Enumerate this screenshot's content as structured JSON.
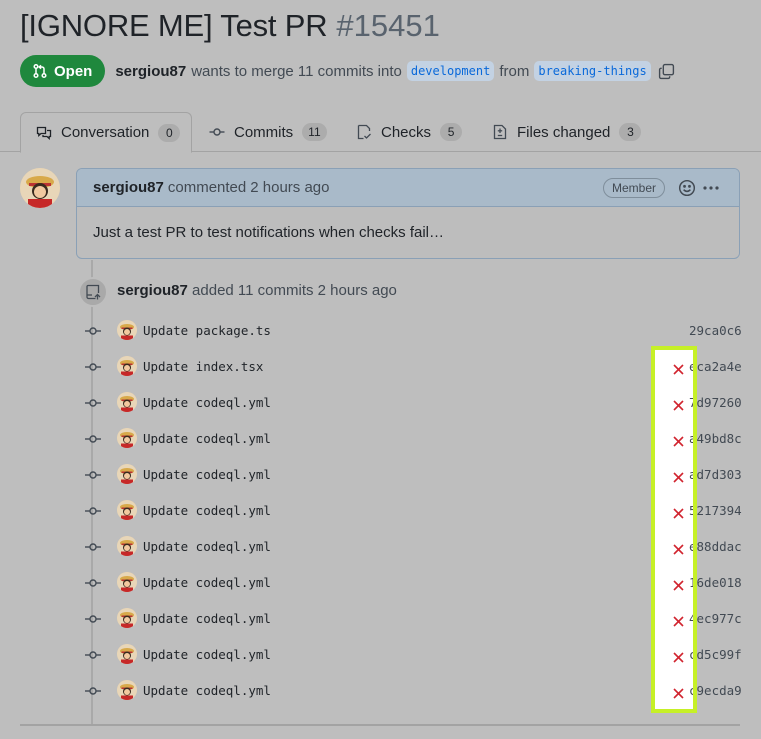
{
  "pr": {
    "title": "[IGNORE ME] Test PR",
    "number": "#15451",
    "state": "Open",
    "author": "sergiou87",
    "merge_text": "wants to merge 11 commits into",
    "base_branch": "development",
    "from_text": "from",
    "head_branch": "breaking-things"
  },
  "tabs": [
    {
      "label": "Conversation",
      "count": "0",
      "icon": "comment-discussion-icon"
    },
    {
      "label": "Commits",
      "count": "11",
      "icon": "git-commit-icon"
    },
    {
      "label": "Checks",
      "count": "5",
      "icon": "checklist-icon"
    },
    {
      "label": "Files changed",
      "count": "3",
      "icon": "file-diff-icon"
    }
  ],
  "comment": {
    "author": "sergiou87",
    "action": "commented",
    "time": "2 hours ago",
    "role": "Member",
    "body": "Just a test PR to test notifications when checks fail…"
  },
  "event": {
    "author": "sergiou87",
    "text": "added 11 commits",
    "time": "2 hours ago"
  },
  "commits": [
    {
      "message": "Update package.ts",
      "sha": "29ca0c6",
      "status": "none"
    },
    {
      "message": "Update index.tsx",
      "sha": "eca2a4e",
      "status": "failed"
    },
    {
      "message": "Update codeql.yml",
      "sha": "7d97260",
      "status": "failed"
    },
    {
      "message": "Update codeql.yml",
      "sha": "a49bd8c",
      "status": "failed"
    },
    {
      "message": "Update codeql.yml",
      "sha": "ad7d303",
      "status": "failed"
    },
    {
      "message": "Update codeql.yml",
      "sha": "5217394",
      "status": "failed"
    },
    {
      "message": "Update codeql.yml",
      "sha": "e88ddac",
      "status": "failed"
    },
    {
      "message": "Update codeql.yml",
      "sha": "16de018",
      "status": "failed"
    },
    {
      "message": "Update codeql.yml",
      "sha": "4ec977c",
      "status": "failed"
    },
    {
      "message": "Update codeql.yml",
      "sha": "cd5c99f",
      "status": "failed"
    },
    {
      "message": "Update codeql.yml",
      "sha": "c9ecda9",
      "status": "failed"
    }
  ],
  "colors": {
    "open_green": "#1f883d",
    "fail_red": "#d1242f",
    "highlight": "#c6f027",
    "link_blue": "#0969da"
  }
}
